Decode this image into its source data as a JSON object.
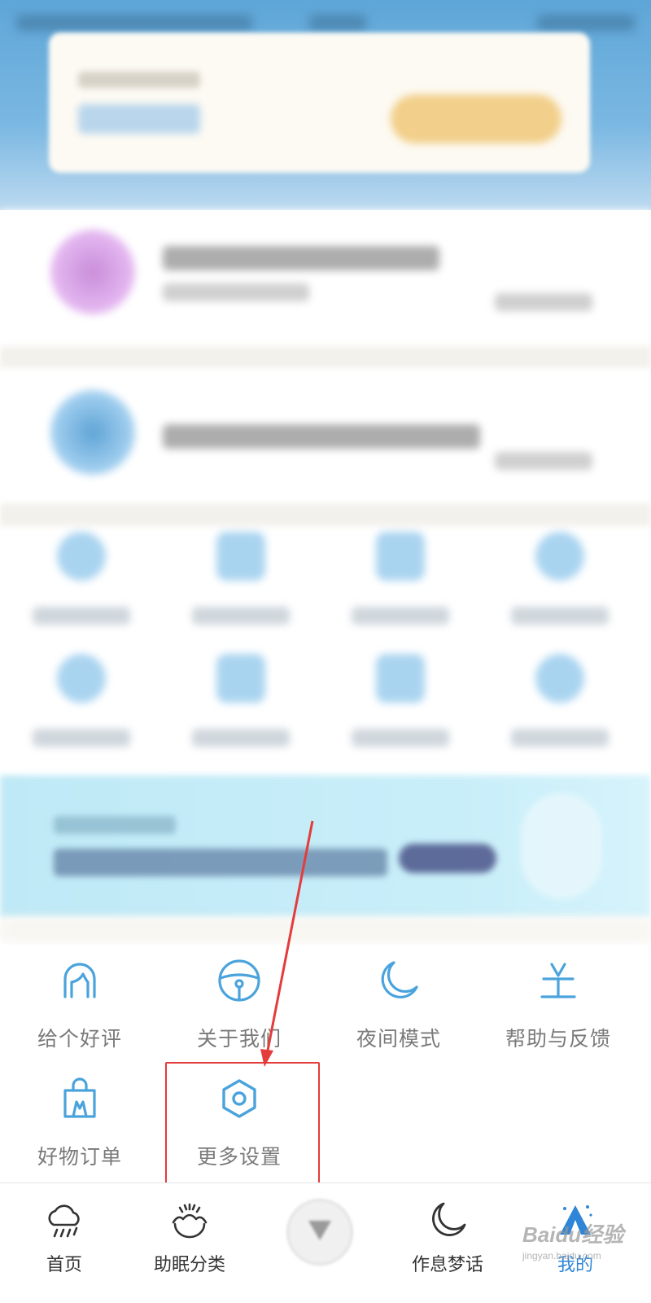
{
  "menu": {
    "items": [
      {
        "label": "给个好评",
        "icon": "face-icon"
      },
      {
        "label": "关于我们",
        "icon": "steering-wheel-icon"
      },
      {
        "label": "夜间模式",
        "icon": "moon-icon"
      },
      {
        "label": "帮助与反馈",
        "icon": "help-desk-icon"
      },
      {
        "label": "好物订单",
        "icon": "shopping-bag-icon"
      },
      {
        "label": "更多设置",
        "icon": "hexagon-settings-icon"
      }
    ]
  },
  "bottom_nav": {
    "items": [
      {
        "label": "首页",
        "icon": "cloud-rain-icon"
      },
      {
        "label": "助眠分类",
        "icon": "sunrise-bowl-icon"
      },
      {
        "label": "作息梦话",
        "icon": "moon-icon"
      },
      {
        "label": "我的",
        "icon": "tent-icon",
        "active": true
      }
    ],
    "center_icon": "play-down-icon"
  },
  "watermark": {
    "brand": "Baidu经验",
    "url": "jingyan.baidu.com"
  },
  "colors": {
    "icon_blue": "#2f86d6",
    "label_gray": "#7a7a7a",
    "highlight_red": "#e43b3b",
    "header_blue": "#5ea6d8"
  }
}
